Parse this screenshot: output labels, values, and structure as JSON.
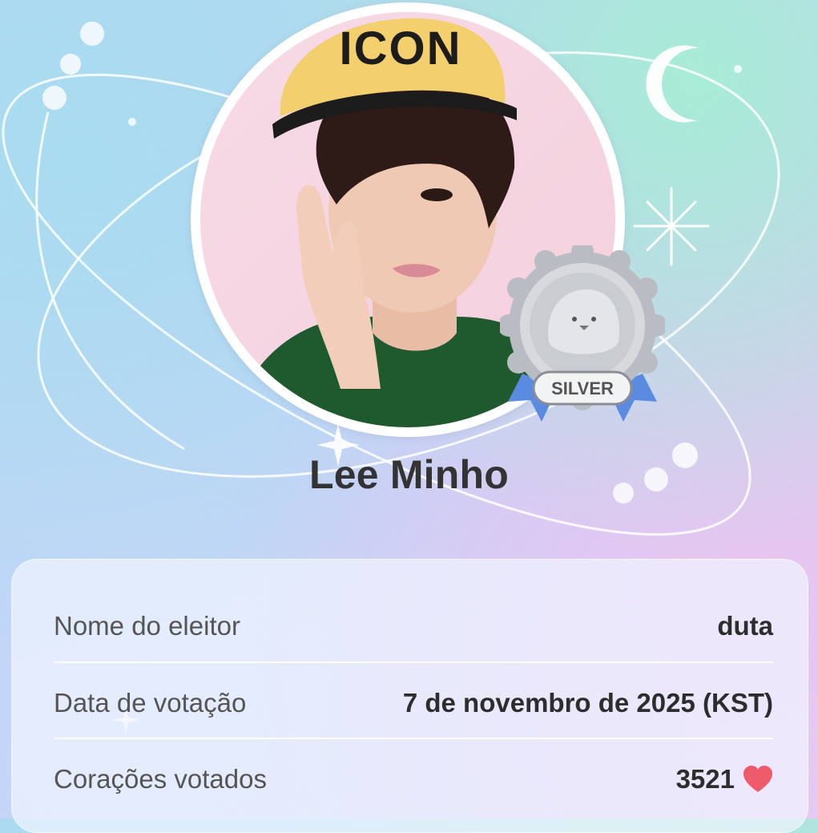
{
  "profile": {
    "name": "Lee Minho",
    "badge_label": "SILVER",
    "cap_text": "ICON"
  },
  "details": [
    {
      "label": "Nome do eleitor",
      "value": "duta"
    },
    {
      "label": "Data de votação",
      "value": "7 de novembro de 2025 (KST)"
    },
    {
      "label": "Corações votados",
      "value": "3521",
      "icon": "heart-icon"
    }
  ],
  "colors": {
    "name_text": "#333333",
    "label_text": "#555555",
    "value_text": "#2d2d2d",
    "heart": "#ef5b6a",
    "badge_silver": "#bfc3c9",
    "ribbon": "#5b8be0",
    "cap": "#f3cf6e",
    "shirt": "#1f5a2e"
  }
}
